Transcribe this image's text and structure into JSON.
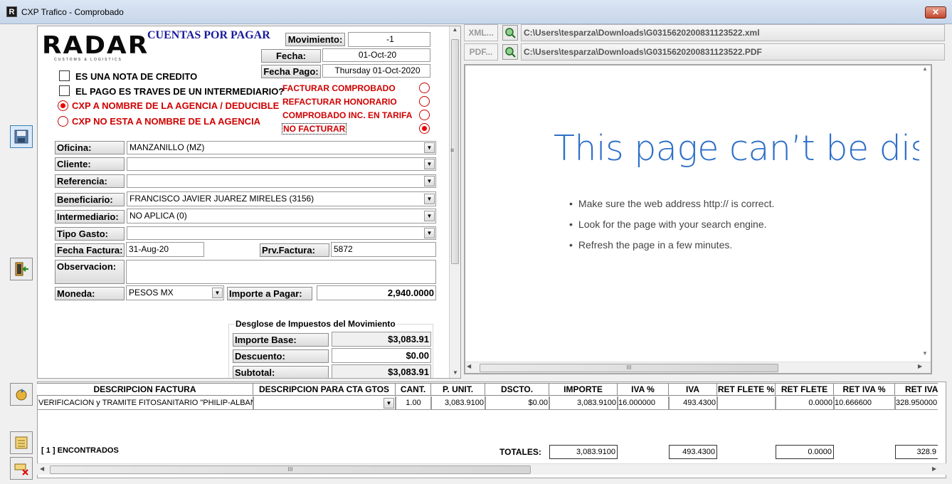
{
  "window": {
    "title": "CXP Trafico - Comprobado",
    "close": "✕"
  },
  "logo": {
    "text": "RADAR",
    "subtitle": "CUSTOMS & LOGISTICS"
  },
  "header": {
    "title": "CUENTAS POR PAGAR"
  },
  "movimiento": {
    "label": "Movimiento:",
    "value": "-1"
  },
  "fecha": {
    "label": "Fecha:",
    "value": "01-Oct-20"
  },
  "fecha_pago": {
    "label": "Fecha Pago:",
    "value": "Thursday 01-Oct-2020"
  },
  "checks": {
    "nota_credito": {
      "label": "ES UNA NOTA DE CREDITO",
      "checked": false
    },
    "intermediario": {
      "label": "EL PAGO ES TRAVES DE UN INTERMEDIARIO?",
      "checked": false
    }
  },
  "agency_radios": [
    {
      "label": "CXP A NOMBRE DE LA AGENCIA / DEDUCIBLE",
      "selected": true
    },
    {
      "label": "CXP NO ESTA A NOMBRE DE LA AGENCIA",
      "selected": false
    }
  ],
  "billing_radios": [
    {
      "label": "FACTURAR COMPROBADO",
      "selected": false
    },
    {
      "label": "REFACTURAR HONORARIO",
      "selected": false
    },
    {
      "label": "COMPROBADO INC. EN TARIFA",
      "selected": false
    },
    {
      "label": "NO FACTURAR",
      "selected": true
    }
  ],
  "form": {
    "oficina": {
      "label": "Oficina:",
      "value": "MANZANILLO (MZ)"
    },
    "cliente": {
      "label": "Cliente:",
      "value": ""
    },
    "referencia": {
      "label": "Referencia:",
      "value": ""
    },
    "beneficiario": {
      "label": "Beneficiario:",
      "value": "FRANCISCO JAVIER JUAREZ MIRELES (3156)"
    },
    "intermediario": {
      "label": "Intermediario:",
      "value": "NO APLICA (0)"
    },
    "tipo_gasto": {
      "label": "Tipo Gasto:",
      "value": ""
    },
    "fecha_factura": {
      "label": "Fecha Factura:",
      "value": "31-Aug-20"
    },
    "prv_factura": {
      "label": "Prv.Factura:",
      "value": "5872"
    },
    "observacion": {
      "label": "Observacion:",
      "value": ""
    },
    "moneda": {
      "label": "Moneda:",
      "value": "PESOS MX"
    },
    "importe_pagar": {
      "label": "Importe a Pagar:",
      "value": "2,940.0000"
    }
  },
  "taxes": {
    "title": "Desglose de Impuestos del Movimiento",
    "importe_base": {
      "label": "Importe Base:",
      "value": "$3,083.91"
    },
    "descuento": {
      "label": "Descuento:",
      "value": "$0.00"
    },
    "subtotal": {
      "label": "Subtotal:",
      "value": "$3,083.91"
    }
  },
  "files": {
    "xml_button": "XML...",
    "xml_path": "C:\\Users\\tesparza\\Downloads\\G0315620200831123522.xml",
    "pdf_button": "PDF...",
    "pdf_path": "C:\\Users\\tesparza\\Downloads\\G0315620200831123522.PDF"
  },
  "browser": {
    "heading": "This page can’t be displa",
    "tips": [
      "Make sure the web address http:// is correct.",
      "Look for the page with your search engine.",
      "Refresh the page in a few minutes."
    ],
    "hscroll_grip": "III"
  },
  "grid": {
    "columns": [
      "DESCRIPCION FACTURA",
      "DESCRIPCION PARA CTA GTOS",
      "CANT.",
      "P. UNIT.",
      "DSCTO.",
      "IMPORTE",
      "IVA %",
      "IVA",
      "RET FLETE %",
      "RET FLETE",
      "RET IVA %",
      "RET IVA"
    ],
    "rows": [
      [
        "VERIFICACION y TRAMITE FITOSANITARIO \"PHILIP-ALBANIA-(",
        "",
        "1.00",
        "3,083.9100",
        "$0.00",
        "3,083.9100",
        "16.000000",
        "493.4300",
        "",
        "0.0000",
        "10.666600",
        "328.950000"
      ]
    ],
    "found": "[ 1 ] ENCONTRADOS",
    "totals_label": "TOTALES:",
    "totals": {
      "importe": "3,083.9100",
      "iva": "493.4300",
      "ret_flete": "0.0000",
      "ret_iva": "328.9"
    },
    "hscroll_grip": "III"
  },
  "icons": {
    "save": "save-icon",
    "exit": "exit-door-icon",
    "refresh": "refresh-icon",
    "list": "list-config-icon",
    "delete": "delete-icon"
  }
}
